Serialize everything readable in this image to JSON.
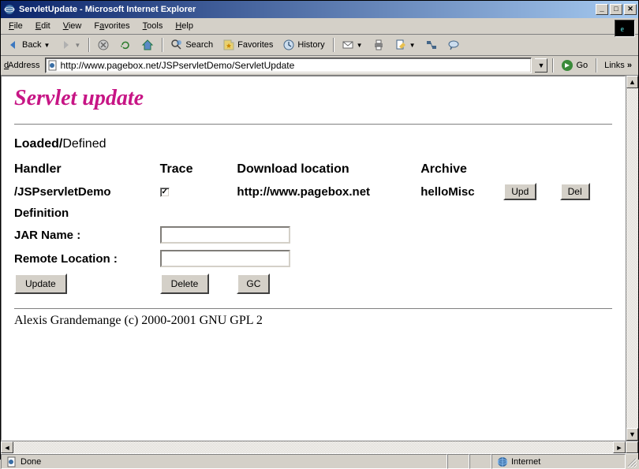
{
  "window": {
    "title": "ServletUpdate - Microsoft Internet Explorer"
  },
  "menu": {
    "file": "File",
    "edit": "Edit",
    "view": "View",
    "favorites": "Favorites",
    "tools": "Tools",
    "help": "Help"
  },
  "toolbar": {
    "back": "Back",
    "search": "Search",
    "favorites": "Favorites",
    "history": "History"
  },
  "address": {
    "label": "Address",
    "url": "http://www.pagebox.net/JSPservletDemo/ServletUpdate",
    "go": "Go",
    "links": "Links"
  },
  "page": {
    "heading": "Servlet update",
    "status_loaded": "Loaded",
    "status_sep": "/",
    "status_defined": "Defined",
    "headers": {
      "handler": "Handler",
      "trace": "Trace",
      "download": "Download location",
      "archive": "Archive"
    },
    "row": {
      "handler": "/JSPservletDemo",
      "trace_checked": "✓",
      "download": "http://www.pagebox.net",
      "archive": "helloMisc",
      "upd": "Upd",
      "del": "Del"
    },
    "definition": "Definition",
    "jar_label": "JAR Name :",
    "remote_label": "Remote Location :",
    "btn_update": "Update",
    "btn_delete": "Delete",
    "btn_gc": "GC",
    "footer": "Alexis Grandemange (c) 2000-2001 GNU GPL 2"
  },
  "status": {
    "done": "Done",
    "zone": "Internet"
  }
}
